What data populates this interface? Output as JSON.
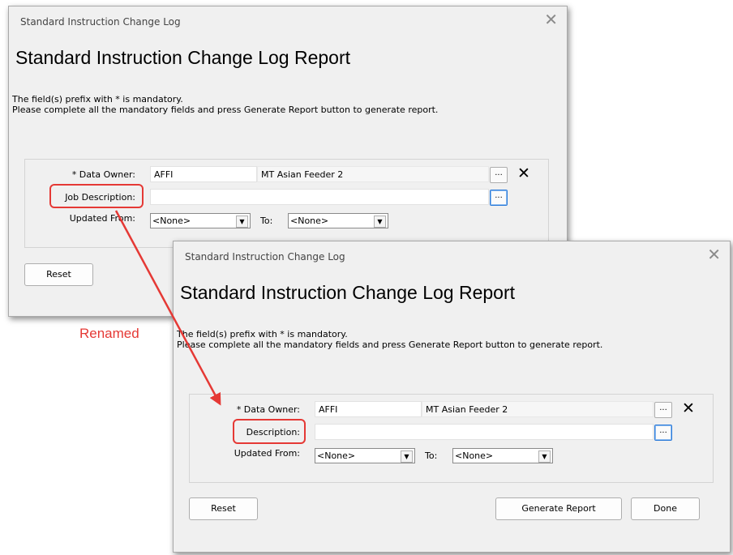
{
  "colors": {
    "annotation": "#e53935",
    "dialog_bg": "#f0f0f0",
    "focus_border": "#2a7ad9"
  },
  "annotation": {
    "label": "Renamed"
  },
  "before": {
    "window_title": "Standard Instruction Change Log",
    "close_glyph": "✕",
    "heading": "Standard Instruction Change Log Report",
    "note_line1": "The field(s) prefix with * is mandatory.",
    "note_line2": "Please complete all the mandatory fields and press Generate Report button to generate report.",
    "data_owner_label": "* Data Owner:",
    "data_owner_code": "AFFI",
    "data_owner_name": "MT Asian Feeder 2",
    "description_label": "Job Description:",
    "description_value": "",
    "updated_from_label": "Updated From:",
    "updated_from_value": "<None>",
    "to_label": "To:",
    "to_value": "<None>",
    "ellipsis": "...",
    "clear_glyph": "✕",
    "reset_label": "Reset"
  },
  "after": {
    "window_title": "Standard Instruction Change Log",
    "close_glyph": "✕",
    "heading": "Standard Instruction Change Log Report",
    "note_line1": "The field(s) prefix with * is mandatory.",
    "note_line2": "Please complete all the mandatory fields and press Generate Report button to generate report.",
    "data_owner_label": "* Data Owner:",
    "data_owner_code": "AFFI",
    "data_owner_name": "MT Asian Feeder 2",
    "description_label": "Description:",
    "description_value": "",
    "updated_from_label": "Updated From:",
    "updated_from_value": "<None>",
    "to_label": "To:",
    "to_value": "<None>",
    "ellipsis": "...",
    "clear_glyph": "✕",
    "reset_label": "Reset",
    "generate_label": "Generate Report",
    "done_label": "Done"
  }
}
